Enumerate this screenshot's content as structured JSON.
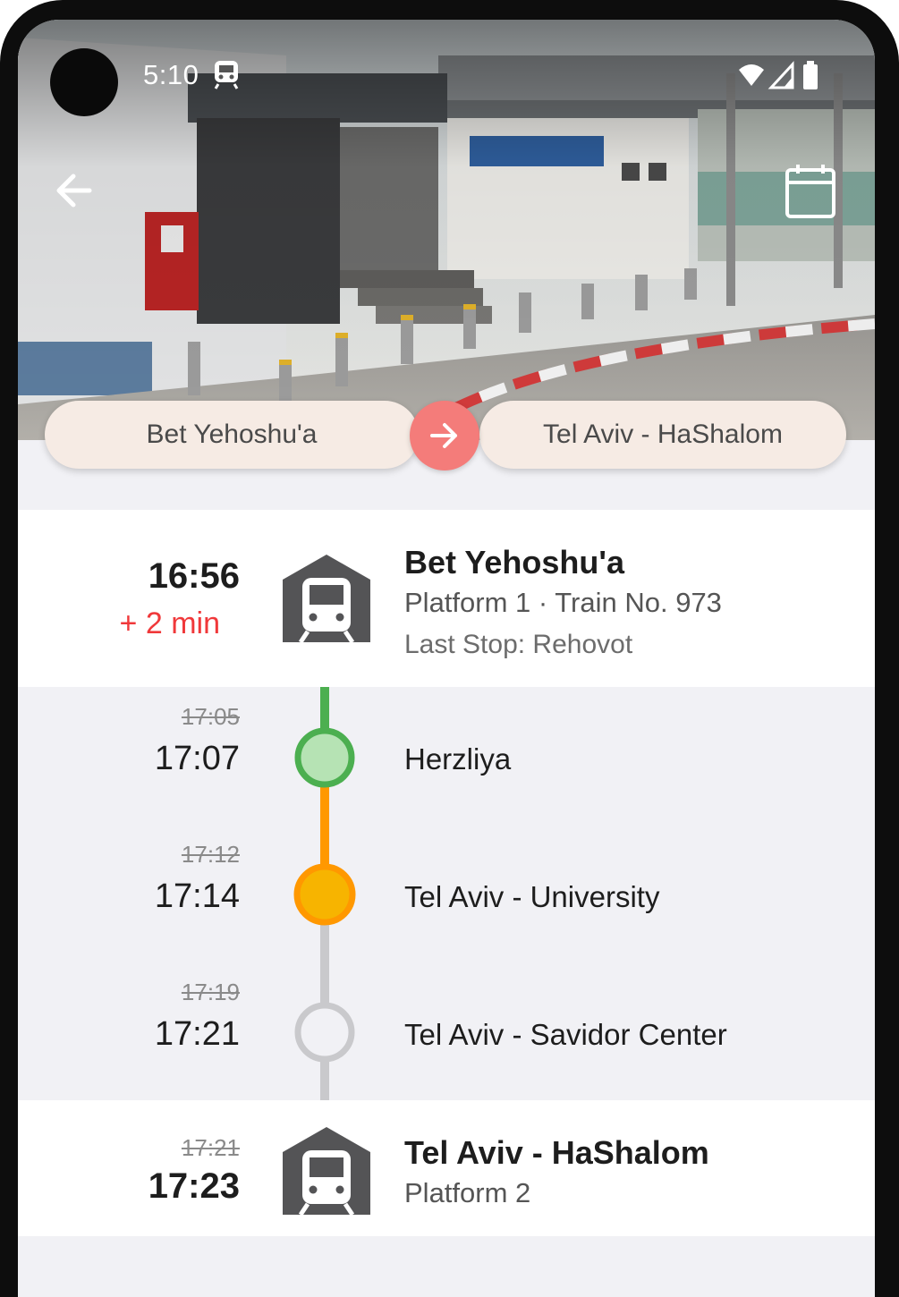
{
  "status": {
    "time": "5:10",
    "icons": [
      "train-notification-icon",
      "wifi-icon",
      "signal-icon",
      "battery-icon"
    ]
  },
  "header": {
    "icons": [
      "back-arrow-icon",
      "calendar-icon"
    ]
  },
  "route": {
    "from": "Bet Yehoshu'a",
    "to": "Tel Aviv - HaShalom",
    "swap_icon": "arrow-right-icon"
  },
  "colors": {
    "accent": "#f47c7a",
    "delay": "#f0383a",
    "passed_line": "#4caf50",
    "current_line": "#ff9800",
    "upcoming_line": "#c9c9cc"
  },
  "origin": {
    "time": "16:56",
    "delay": "+ 2 min",
    "name": "Bet Yehoshu'a",
    "details": "Platform 1 · Train No. 973",
    "last_stop": "Last Stop: Rehovot",
    "icon": "train-station-icon"
  },
  "stops": [
    {
      "scheduled": "17:05",
      "actual": "17:07",
      "name": "Herzliya",
      "state": "passed"
    },
    {
      "scheduled": "17:12",
      "actual": "17:14",
      "name": "Tel Aviv - University",
      "state": "current"
    },
    {
      "scheduled": "17:19",
      "actual": "17:21",
      "name": "Tel Aviv - Savidor Center",
      "state": "upcoming"
    }
  ],
  "destination": {
    "scheduled": "17:21",
    "actual": "17:23",
    "name": "Tel Aviv - HaShalom",
    "details": "Platform 2",
    "icon": "train-station-icon"
  }
}
